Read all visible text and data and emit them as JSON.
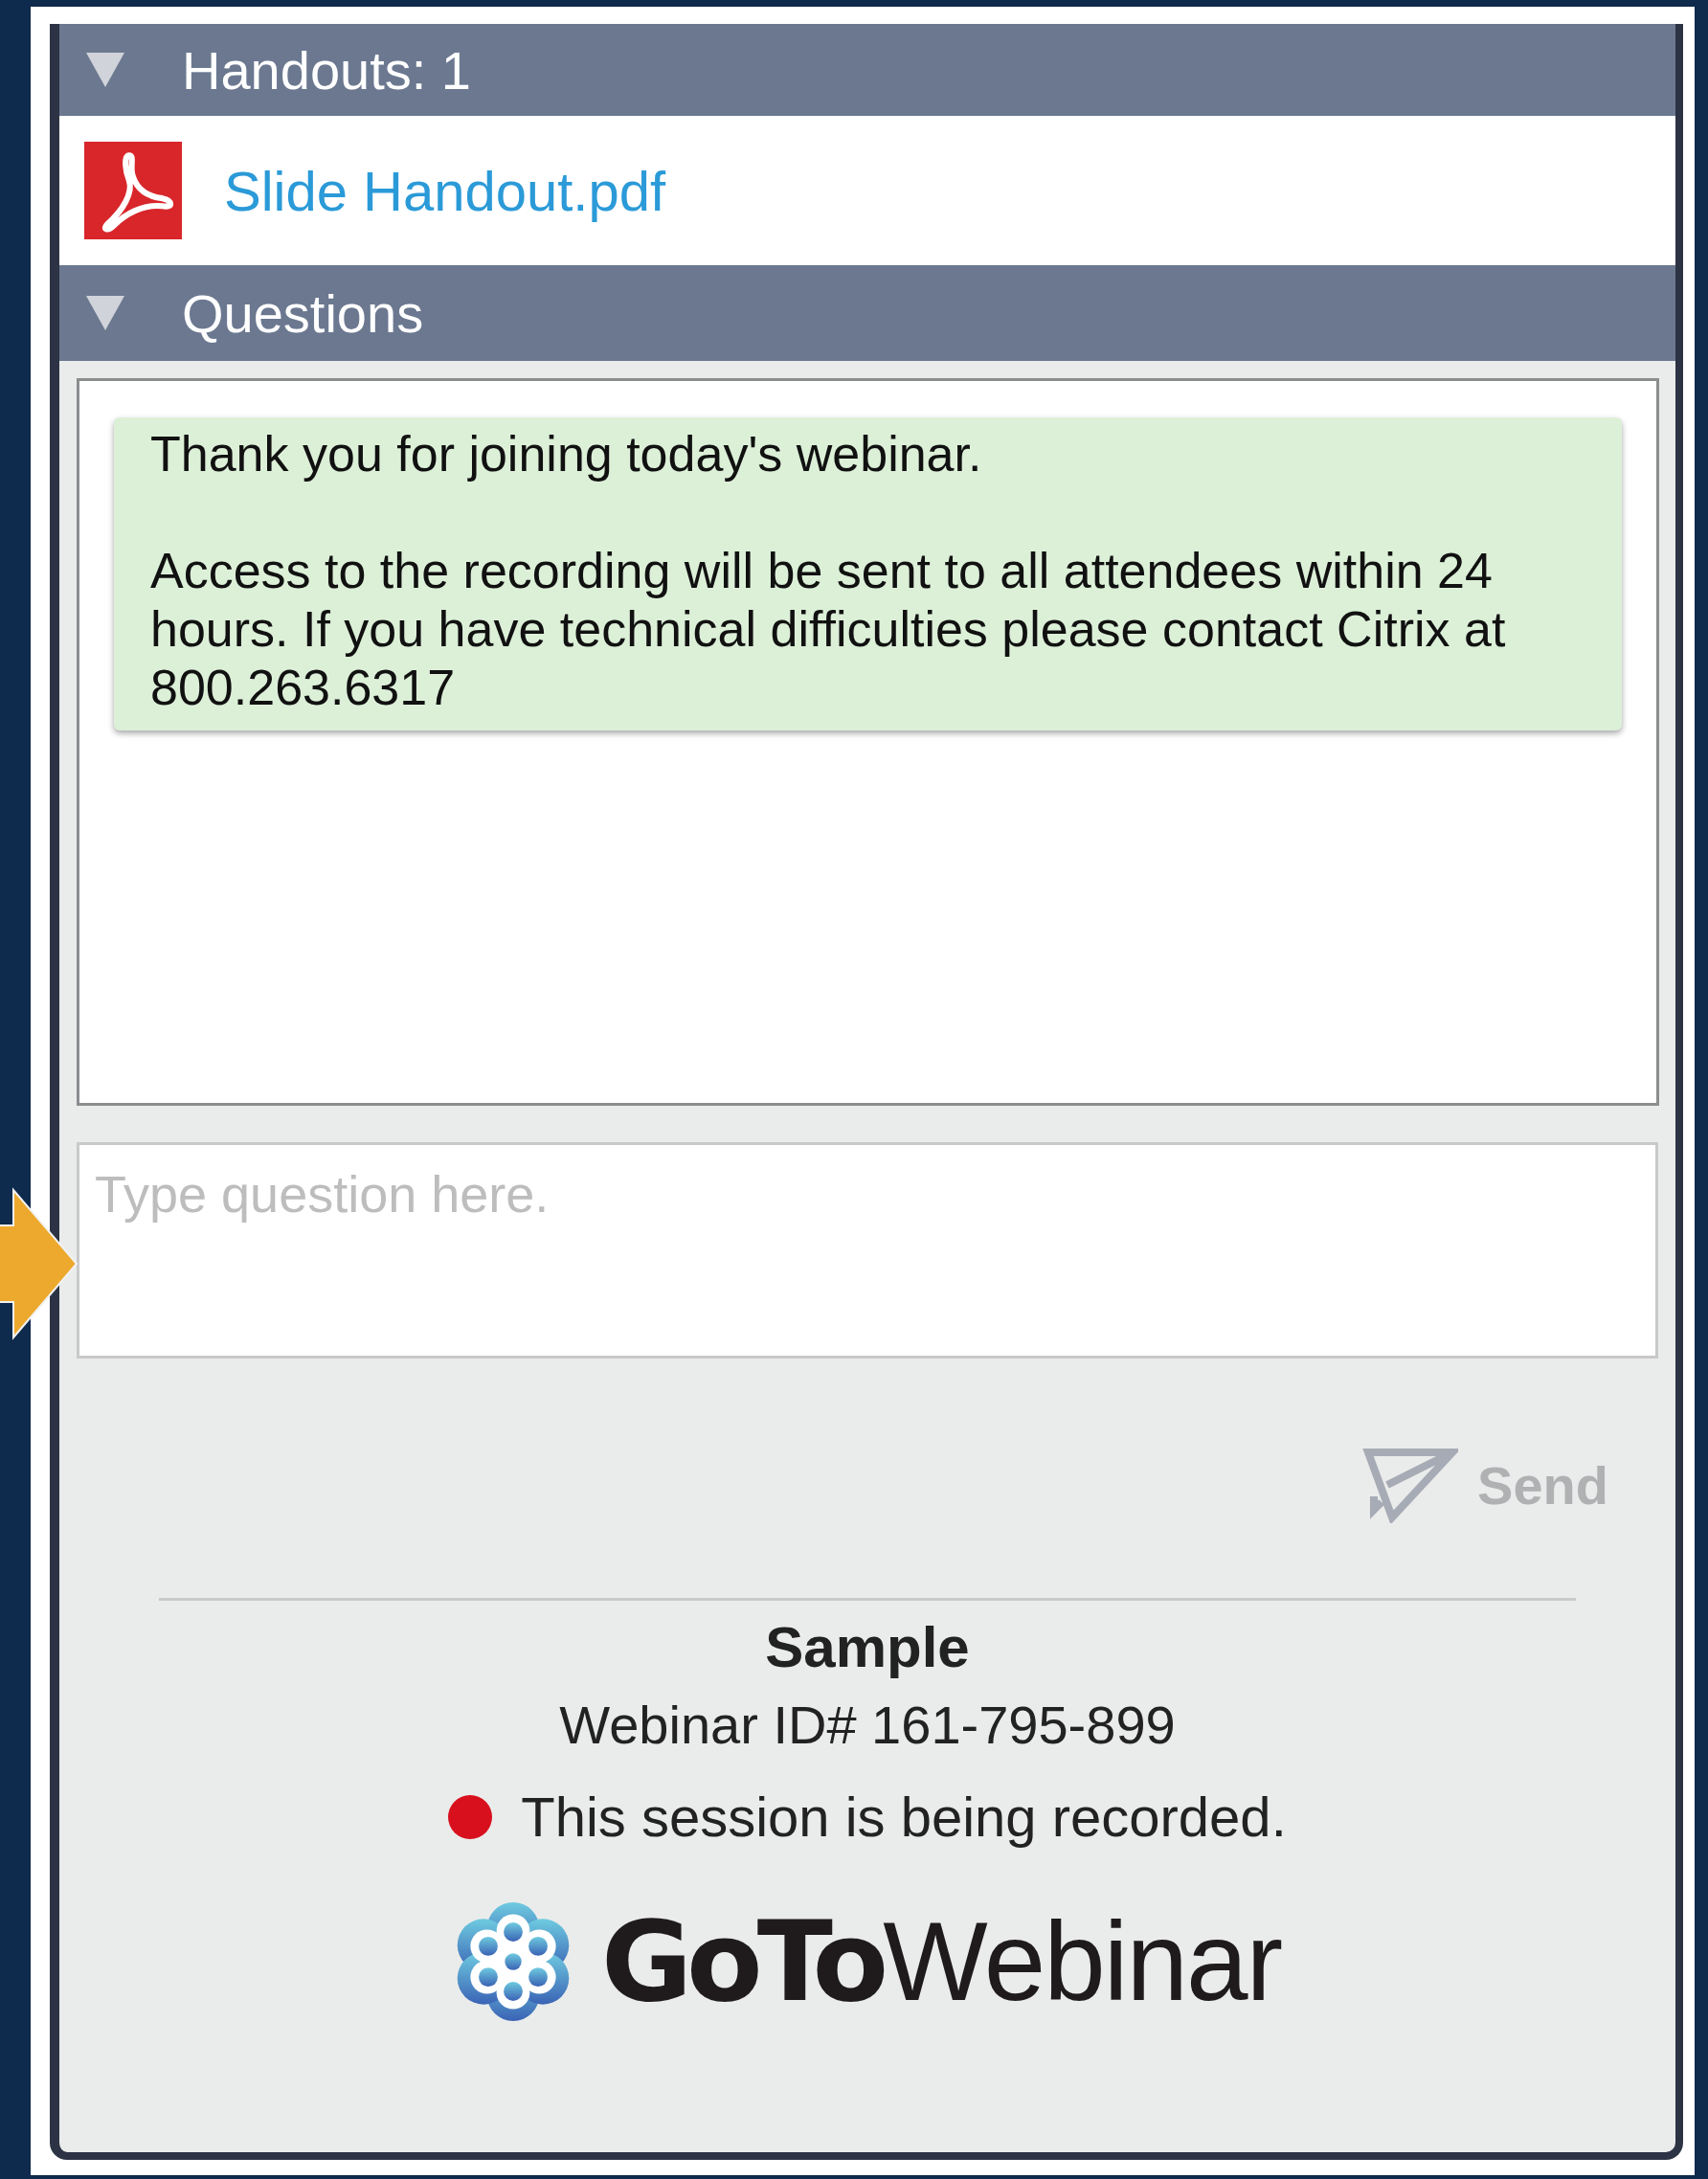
{
  "handouts": {
    "title": "Handouts: 1",
    "expanded": true,
    "files": [
      {
        "name": "Slide Handout.pdf"
      }
    ]
  },
  "questions": {
    "title": "Questions",
    "expanded": true,
    "messages": [
      {
        "paragraphs": [
          "Thank you for joining today's webinar.",
          "Access to the recording will be sent to all attendees within 24 hours. If you have technical difficulties please contact Citrix at 800.263.6317"
        ]
      }
    ],
    "input": {
      "placeholder": "Type question here."
    },
    "send_button": {
      "label": "Send",
      "disabled": true
    }
  },
  "footer": {
    "title": "Sample",
    "webinar_id": "Webinar ID# 161-795-899",
    "recording": {
      "text": "This session is being recorded.",
      "on": true
    },
    "logo": {
      "bold": "GoTo",
      "light": "Webinar"
    }
  }
}
